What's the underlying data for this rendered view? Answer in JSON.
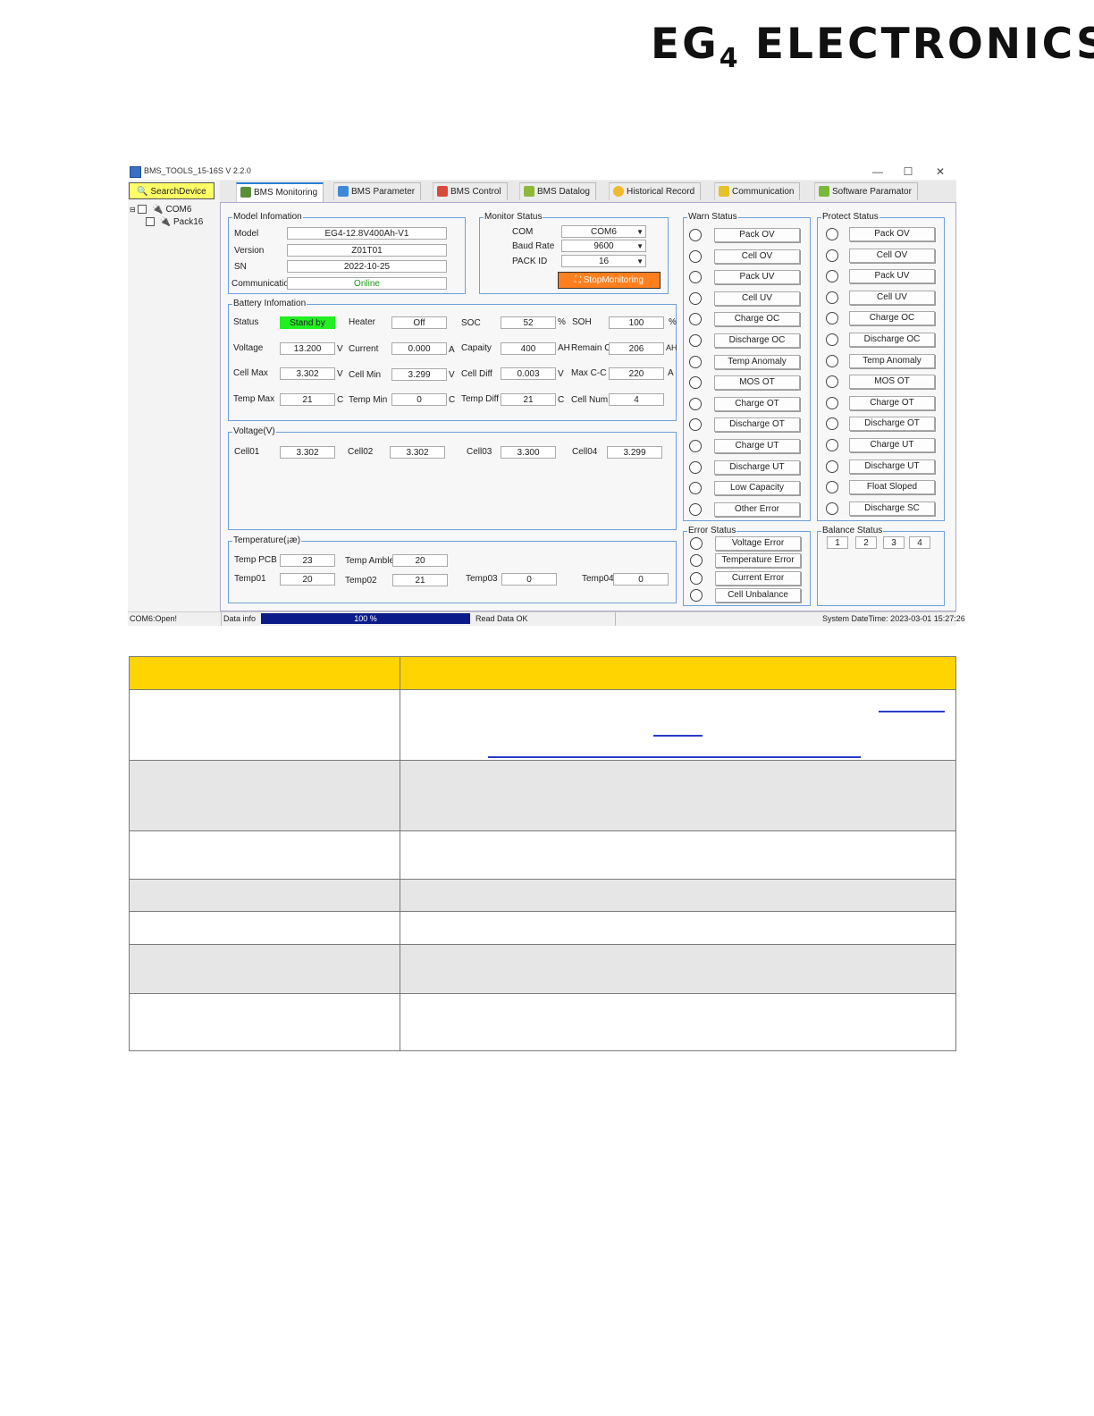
{
  "logo": {
    "part1": "EG",
    "part2": "4",
    "part3": " ELECTRONICS"
  },
  "window": {
    "title": "BMS_TOOLS_15-16S V 2.2.0",
    "controls": {
      "minimize": "—",
      "maximize": "☐",
      "close": "✕"
    }
  },
  "search_button": "SearchDevice",
  "tree": {
    "com": "COM6",
    "pack": "Pack16"
  },
  "tabs": [
    "BMS Monitoring",
    "BMS Parameter",
    "BMS Control",
    "BMS Datalog",
    "Historical Record",
    "Communication",
    "Software Paramator"
  ],
  "model_info": {
    "title": "Model Infomation",
    "model_label": "Model",
    "model_value": "EG4-12.8V400Ah-V1",
    "version_label": "Version",
    "version_value": "Z01T01",
    "sn_label": "SN",
    "sn_value": "2022-10-25",
    "comm_label": "Communicatio",
    "comm_value": "Online"
  },
  "monitor_status": {
    "title": "Monitor Status",
    "com_label": "COM",
    "com_value": "COM6",
    "baud_label": "Baud Rate",
    "baud_value": "9600",
    "packid_label": "PACK ID",
    "packid_value": "16",
    "stop_button": "StopMonitoring"
  },
  "battery_info": {
    "title": "Battery Infomation",
    "status_label": "Status",
    "status_value": "Stand by",
    "heater_label": "Heater",
    "heater_value": "Off",
    "soc_label": "SOC",
    "soc_value": "52",
    "soc_unit": "%",
    "soh_label": "SOH",
    "soh_value": "100",
    "soh_unit": "%",
    "voltage_label": "Voltage",
    "voltage_value": "13.200",
    "voltage_unit": "V",
    "current_label": "Current",
    "current_value": "0.000",
    "current_unit": "A",
    "capacity_label": "Capaity",
    "capacity_value": "400",
    "capacity_unit": "AH",
    "remain_label": "Remain C",
    "remain_value": "206",
    "remain_unit": "AH",
    "cellmax_label": "Cell Max",
    "cellmax_value": "3.302",
    "cellmax_unit": "V",
    "cellmin_label": "Cell Min",
    "cellmin_value": "3.299",
    "cellmin_unit": "V",
    "celldiff_label": "Cell Diff",
    "celldiff_value": "0.003",
    "celldiff_unit": "V",
    "maxcc_label": "Max C-C",
    "maxcc_value": "220",
    "maxcc_unit": "A",
    "tempmax_label": "Temp Max",
    "tempmax_value": "21",
    "tempmax_unit": "C",
    "tempmin_label": "Temp Min",
    "tempmin_value": "0",
    "tempmin_unit": "C",
    "tempdiff_label": "Temp Diff",
    "tempdiff_value": "21",
    "tempdiff_unit": "C",
    "cellnum_label": "Cell Num",
    "cellnum_value": "4"
  },
  "voltage": {
    "title": "Voltage(V)",
    "cells": [
      {
        "label": "Cell01",
        "value": "3.302"
      },
      {
        "label": "Cell02",
        "value": "3.302"
      },
      {
        "label": "Cell03",
        "value": "3.300"
      },
      {
        "label": "Cell04",
        "value": "3.299"
      }
    ]
  },
  "temperature": {
    "title": "Temperature(¡æ)",
    "pcb_label": "Temp PCB",
    "pcb_value": "23",
    "amb_label": "Temp Amble",
    "amb_value": "20",
    "t1_label": "Temp01",
    "t1_value": "20",
    "t2_label": "Temp02",
    "t2_value": "21",
    "t3_label": "Temp03",
    "t3_value": "0",
    "t4_label": "Temp04",
    "t4_value": "0"
  },
  "warn_status": {
    "title": "Warn Status",
    "items": [
      "Pack OV",
      "Cell OV",
      "Pack UV",
      "Cell UV",
      "Charge OC",
      "Discharge OC",
      "Temp Anomaly",
      "MOS OT",
      "Charge OT",
      "Discharge OT",
      "Charge UT",
      "Discharge UT",
      "Low Capacity",
      "Other Error"
    ]
  },
  "protect_status": {
    "title": "Protect Status",
    "items": [
      "Pack OV",
      "Cell OV",
      "Pack UV",
      "Cell UV",
      "Charge OC",
      "Discharge OC",
      "Temp Anomaly",
      "MOS OT",
      "Charge OT",
      "Discharge OT",
      "Charge UT",
      "Discharge UT",
      "Float Sloped",
      "Discharge SC"
    ]
  },
  "error_status": {
    "title": "Error Status",
    "items": [
      "Voltage Error",
      "Temperature Error",
      "Current Error",
      "Cell Unbalance"
    ]
  },
  "balance_status": {
    "title": "Balance Status",
    "items": [
      "1",
      "2",
      "3",
      "4"
    ]
  },
  "statusbar": {
    "port": "COM6:Open!",
    "data_info": "Data info",
    "progress_text": "100 %",
    "progress": 1.0,
    "read": "Read Data OK",
    "datetime": "System DateTime: 2023-03-01 15:27:26"
  },
  "colors": {
    "accent_tab": "#2c7fd6",
    "status_green": "#22ee22",
    "stop_orange": "#ff7f1f",
    "progress": "#0b1c8a",
    "table_header": "#ffd400"
  }
}
